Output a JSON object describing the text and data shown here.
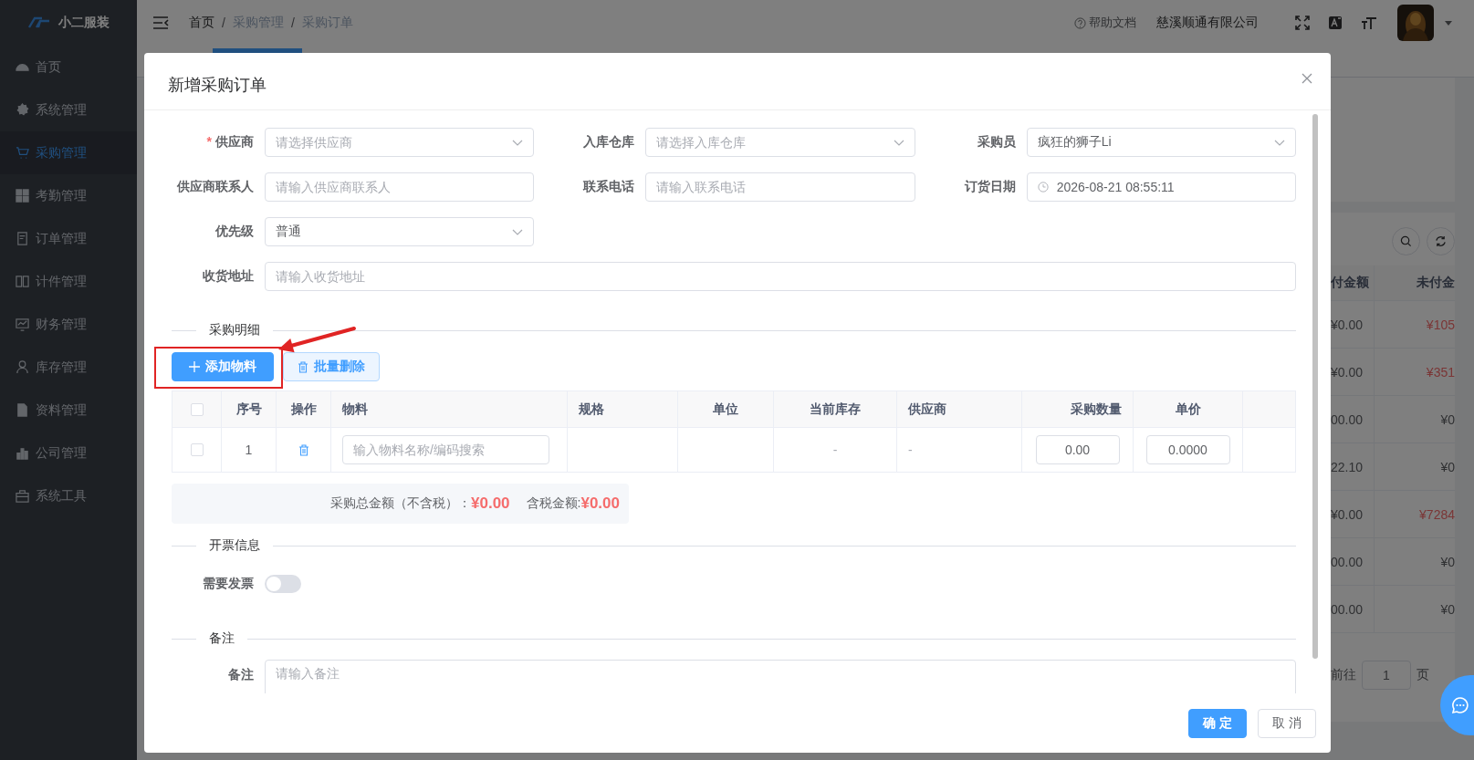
{
  "app": {
    "logo": "小二服装"
  },
  "sidebar": {
    "items": [
      {
        "label": "首页",
        "selected": false
      },
      {
        "label": "系统管理",
        "selected": false
      },
      {
        "label": "采购管理",
        "selected": true
      },
      {
        "label": "考勤管理",
        "selected": false
      },
      {
        "label": "订单管理",
        "selected": false
      },
      {
        "label": "计件管理",
        "selected": false
      },
      {
        "label": "财务管理",
        "selected": false
      },
      {
        "label": "库存管理",
        "selected": false
      },
      {
        "label": "资料管理",
        "selected": false
      },
      {
        "label": "公司管理",
        "selected": false
      },
      {
        "label": "系统工具",
        "selected": false
      }
    ]
  },
  "header": {
    "breadcrumb": [
      "首页",
      "采购管理",
      "采购订单"
    ],
    "breadcrumb_separators": [
      "/",
      "/"
    ],
    "help": "帮助文档",
    "company": "慈溪顺通有限公司"
  },
  "background_table": {
    "columns": [
      "付金额",
      "未付金"
    ],
    "rows": [
      {
        "column_1": "¥0.00",
        "column_2": "¥105",
        "alert": true
      },
      {
        "column_1": "¥0.00",
        "column_2": "¥351",
        "alert": true
      },
      {
        "column_1": "00.00",
        "column_2": "¥0",
        "alert": false
      },
      {
        "column_1": "22.10",
        "column_2": "¥0",
        "alert": false
      },
      {
        "column_1": "¥0.00",
        "column_2": "¥7284",
        "alert": true
      },
      {
        "column_1": "00.00",
        "column_2": "¥0",
        "alert": false
      },
      {
        "column_1": "00.00",
        "column_2": "¥0",
        "alert": false
      }
    ]
  },
  "pagination": {
    "goto_label": "前往",
    "page": "1",
    "suffix": "页"
  },
  "dialog": {
    "title": "新增采购订单",
    "fields": [
      {
        "label": "供应商",
        "kind": "select",
        "placeholder": "请选择供应商",
        "required_mark": "*"
      },
      {
        "label": "入库仓库",
        "kind": "select",
        "placeholder": "请选择入库仓库"
      },
      {
        "label": "采购员",
        "kind": "select",
        "value": "疯狂的狮子Li"
      },
      {
        "label": "供应商联系人",
        "kind": "input",
        "placeholder": "请输入供应商联系人"
      },
      {
        "label": "联系电话",
        "kind": "input",
        "placeholder": "请输入联系电话"
      },
      {
        "label": "订货日期",
        "kind": "date",
        "value": "2026-08-21 08:55:11"
      },
      {
        "label": "优先级",
        "kind": "select",
        "value": "普通"
      },
      {
        "label": "收货地址",
        "kind": "wide",
        "placeholder": "请输入收货地址"
      }
    ],
    "details": {
      "title": "采购明细",
      "add_button": "添加物料",
      "delete_button": "批量删除",
      "all_checked": false,
      "columns": [
        "序号",
        "操作",
        "物料",
        "规格",
        "单位",
        "当前库存",
        "供应商",
        "采购数量",
        "单价"
      ],
      "rows": [
        {
          "checked": false,
          "index": "1",
          "material_placeholder": "输入物料名称/编码搜索",
          "stock": "-",
          "supplier": "-",
          "quantity": "0.00",
          "unit_price": "0.0000"
        }
      ],
      "summary": {
        "net_label": "采购总金额（不含税）：",
        "net_value": "¥0.00",
        "gross_label": "含税金额:",
        "gross_value": "¥0.00"
      }
    },
    "invoice": {
      "title": "开票信息",
      "label": "需要发票",
      "on": false
    },
    "remark": {
      "title": "备注",
      "label": "备注",
      "placeholder": "请输入备注"
    },
    "buttons": {
      "confirm": "确 定",
      "cancel": "取 消"
    }
  }
}
